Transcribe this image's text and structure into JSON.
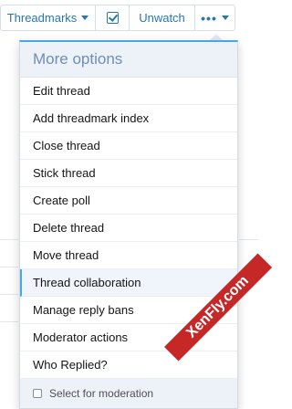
{
  "toolbar": {
    "threadmarks_label": "Threadmarks",
    "unwatch_label": "Unwatch",
    "more_glyph": "•••"
  },
  "menu": {
    "title": "More options",
    "items": [
      {
        "label": "Edit thread"
      },
      {
        "label": "Add threadmark index"
      },
      {
        "label": "Close thread"
      },
      {
        "label": "Stick thread"
      },
      {
        "label": "Create poll"
      },
      {
        "label": "Delete thread"
      },
      {
        "label": "Move thread"
      },
      {
        "label": "Thread collaboration"
      },
      {
        "label": "Manage reply bans"
      },
      {
        "label": "Moderator actions"
      },
      {
        "label": "Who Replied?"
      }
    ],
    "footer_label": "Select for moderation"
  },
  "watermark": "XenFly.com",
  "colors": {
    "link": "#2577b1",
    "accent": "#47a7eb",
    "header_bg": "#edf2f8",
    "header_text": "#6f8eb3",
    "watermark_bg": "#c62828"
  }
}
